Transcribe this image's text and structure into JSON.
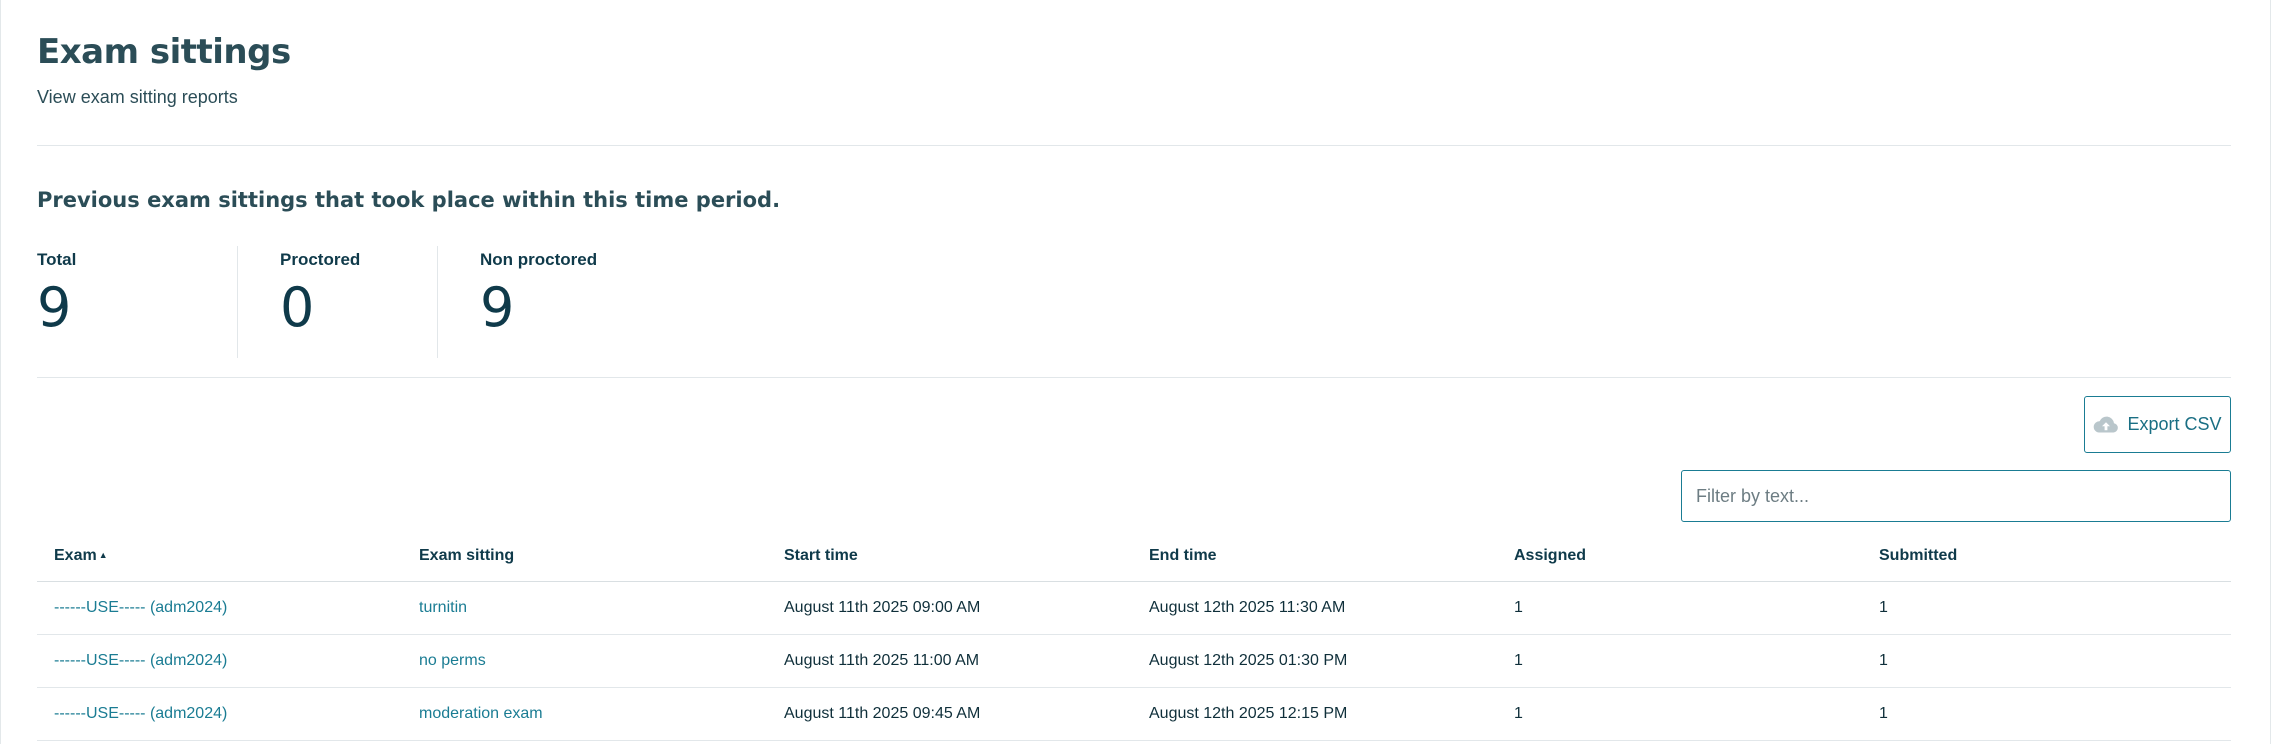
{
  "header": {
    "title": "Exam sittings",
    "subtitle": "View exam sitting reports"
  },
  "summary": {
    "heading": "Previous exam sittings that took place within this time period.",
    "stats": [
      {
        "label": "Total",
        "value": "9"
      },
      {
        "label": "Proctored",
        "value": "0"
      },
      {
        "label": "Non proctored",
        "value": "9"
      }
    ]
  },
  "toolbar": {
    "export_label": "Export CSV",
    "export_icon": "cloud-upload-icon",
    "filter_placeholder": "Filter by text...",
    "filter_value": ""
  },
  "table": {
    "columns": [
      "Exam",
      "Exam sitting",
      "Start time",
      "End time",
      "Assigned",
      "Submitted"
    ],
    "sort_indicator": "▲",
    "rows": [
      {
        "exam": "------USE----- (adm2024)",
        "sitting": "turnitin",
        "start": "August 11th 2025 09:00 AM",
        "end": "August 12th 2025 11:30 AM",
        "assigned": "1",
        "submitted": "1"
      },
      {
        "exam": "------USE----- (adm2024)",
        "sitting": "no perms",
        "start": "August 11th 2025 11:00 AM",
        "end": "August 12th 2025 01:30 PM",
        "assigned": "1",
        "submitted": "1"
      },
      {
        "exam": "------USE----- (adm2024)",
        "sitting": "moderation exam",
        "start": "August 11th 2025 09:45 AM",
        "end": "August 12th 2025 12:15 PM",
        "assigned": "1",
        "submitted": "1"
      }
    ]
  },
  "colors": {
    "accent": "#1a7c93",
    "text_dark": "#0f3a4a",
    "heading": "#2b4d57"
  }
}
